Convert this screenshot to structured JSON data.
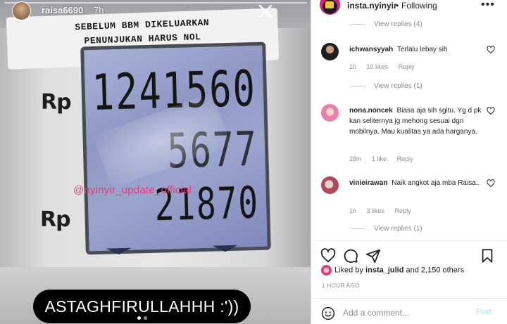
{
  "story": {
    "username": "raisa6690",
    "time": "7h",
    "sign_line_1": "SEBELUM BBM DIKELUARKAN",
    "sign_line_2": "PENUNJUKAN HARUS NOL",
    "rp_label_1": "Rp",
    "rp_label_2": "Rp",
    "display_line_1": "1241560",
    "display_line_2": "5677",
    "display_line_3": "21870",
    "watermark": "@nyinyir_update_official",
    "caption": "ASTAGHFIRULLAHHH :'))",
    "icons": [
      "close-icon"
    ]
  },
  "post": {
    "username": "insta.nyinyir",
    "separator": "•",
    "following_label": "Following",
    "more_label": "•••"
  },
  "comments": {
    "view_replies_top": "View replies (4)",
    "items": [
      {
        "user": "ichwansyyah",
        "text": "Terlalu lebay sih",
        "time": "1h",
        "likes": "10 likes",
        "reply": "Reply",
        "view_replies": "View replies (1)"
      },
      {
        "user": "nona.noncek",
        "text": "Biasa aja sih sgitu. Yg d pk kan seliternya jg mehong sesuai dgn mobilnya. Mau kualitas ya ada harganya.",
        "time": "28m",
        "likes": "1 like",
        "reply": "Reply"
      },
      {
        "user": "vinieirawan",
        "text": "Naik angkot aja mba Raisa..",
        "time": "1h",
        "likes": "3 likes",
        "reply": "Reply",
        "view_replies": "View replies (1)"
      }
    ]
  },
  "actions": {
    "icons": [
      "heart-icon",
      "comment-icon",
      "share-icon",
      "bookmark-icon"
    ]
  },
  "likes": {
    "prefix": "Liked by",
    "user": "insta_julid",
    "suffix": "and 2,150 others"
  },
  "post_time": "1 HOUR AGO",
  "add_comment": {
    "placeholder": "Add a comment...",
    "post_label": "Post"
  },
  "colors": {
    "accent_pink": "#e03a7e",
    "post_button_disabled": "#b2dffc",
    "lcd_blue": "#8f98c5"
  }
}
